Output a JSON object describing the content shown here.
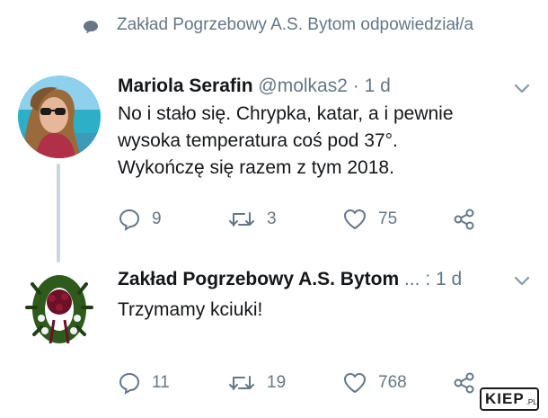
{
  "context": {
    "text": "Zakład Pogrzebowy A.S. Bytom odpowiedział/a",
    "icon": "speech-bubble-icon"
  },
  "colors": {
    "text": "#14171a",
    "muted": "#657786",
    "thread_line": "#ccd6dd"
  },
  "tweets": [
    {
      "author_name": "Mariola Serafin",
      "handle": "@molkas2",
      "time": "1 d",
      "lines": [
        "No i stało się. Chrypka, katar, a i pewnie",
        "wysoka temperatura coś pod 37°.",
        "Wykończę się razem z tym 2018."
      ],
      "replies": "9",
      "retweets": "3",
      "likes": "75"
    },
    {
      "author_name": "Zakład Pogrzebowy A.S. Bytom",
      "handle": "...",
      "time": "1 d",
      "lines": [
        "Trzymamy kciuki!"
      ],
      "replies": "11",
      "retweets": "19",
      "likes": "768"
    }
  ],
  "watermark": {
    "main": "KIEP",
    "sub": ".PL"
  }
}
